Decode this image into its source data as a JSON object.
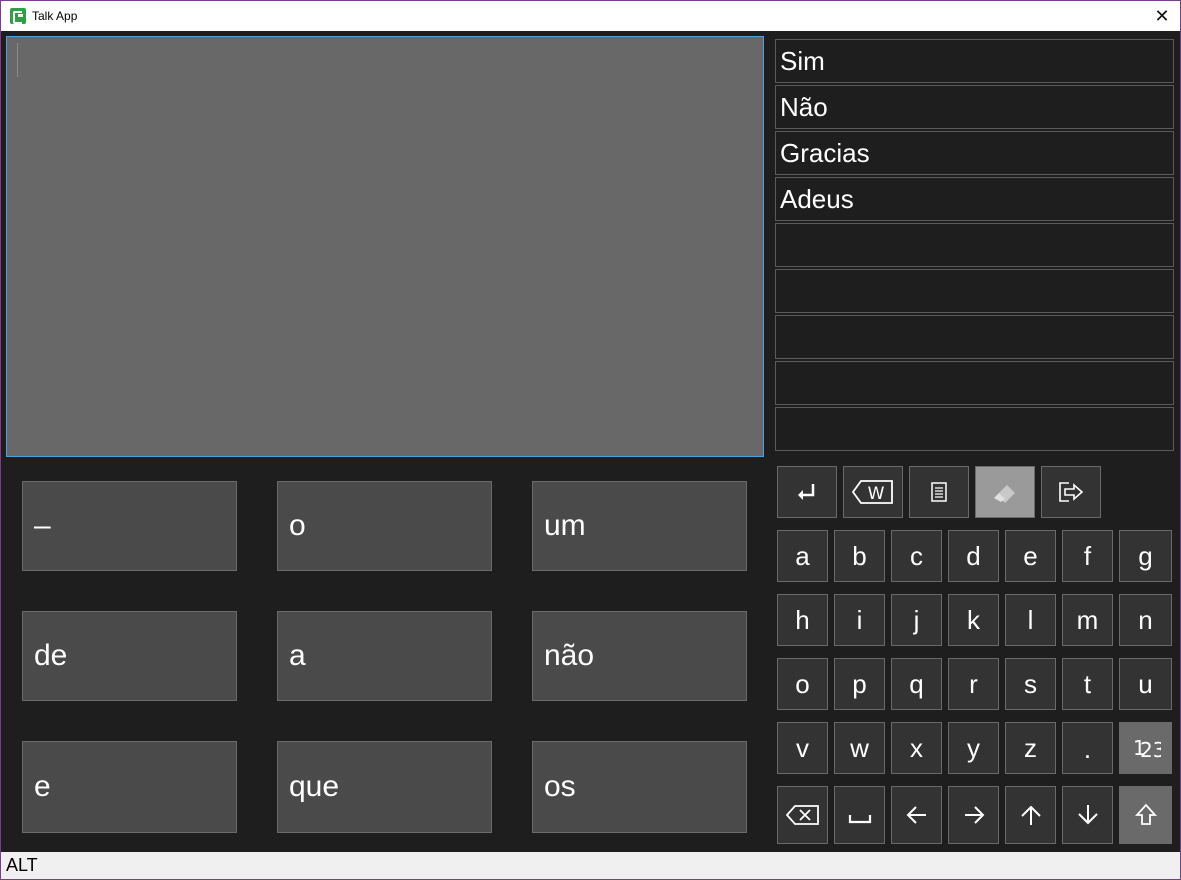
{
  "window": {
    "title": "Talk App"
  },
  "phrases": [
    "Sim",
    "Não",
    "Gracias",
    "Adeus",
    "",
    "",
    "",
    "",
    ""
  ],
  "predictions": {
    "p1": "–",
    "p2": "o",
    "p3": "um",
    "p4": "de",
    "p5": "a",
    "p6": "não",
    "p7": "e",
    "p8": "que",
    "p9": "os"
  },
  "keys": {
    "row1": [
      "a",
      "b",
      "c",
      "d",
      "e",
      "f",
      "g"
    ],
    "row2": [
      "h",
      "i",
      "j",
      "k",
      "l",
      "m",
      "n"
    ],
    "row3": [
      "o",
      "p",
      "q",
      "r",
      "s",
      "t",
      "u"
    ],
    "row4": [
      "v",
      "w",
      "x",
      "y",
      "z",
      "."
    ]
  },
  "status": {
    "text": "ALT"
  }
}
